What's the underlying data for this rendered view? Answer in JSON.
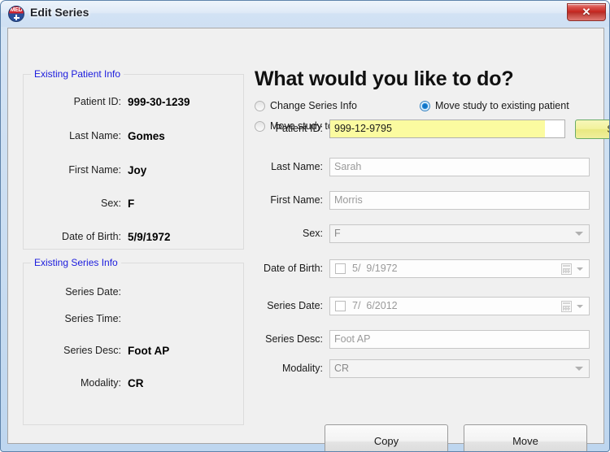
{
  "window": {
    "title": "Edit Series",
    "app_icon": "med-badge-icon",
    "close_label": "✕"
  },
  "existing_patient": {
    "legend": "Existing Patient Info",
    "rows": [
      {
        "label": "Patient ID:",
        "value": "999-30-1239"
      },
      {
        "label": "Last Name:",
        "value": "Gomes"
      },
      {
        "label": "First Name:",
        "value": "Joy"
      },
      {
        "label": "Sex:",
        "value": "F"
      },
      {
        "label": "Date of Birth:",
        "value": "5/9/1972"
      }
    ]
  },
  "existing_series": {
    "legend": "Existing Series Info",
    "rows": [
      {
        "label": "Series Date:",
        "value": ""
      },
      {
        "label": "Series Time:",
        "value": ""
      },
      {
        "label": "Series Desc:",
        "value": "Foot AP"
      },
      {
        "label": "Modality:",
        "value": "CR"
      }
    ]
  },
  "prompt": {
    "heading": "What would you like to do?",
    "options": [
      {
        "label": "Change Series Info",
        "selected": false
      },
      {
        "label": "Move study to new patient",
        "selected": false
      },
      {
        "label": "Move study to existing patient",
        "selected": true
      }
    ]
  },
  "form": {
    "patient_id_label": "Patient ID:",
    "patient_id_value": "999-12-9795",
    "search_label": "Search",
    "last_name_label": "Last Name:",
    "last_name_value": "Sarah",
    "first_name_label": "First Name:",
    "first_name_value": "Morris",
    "sex_label": "Sex:",
    "sex_value": "F",
    "dob_label": "Date of Birth:",
    "dob_value": "5/  9/1972",
    "series_date_label": "Series Date:",
    "series_date_value": "7/  6/2012",
    "series_desc_label": "Series Desc:",
    "series_desc_value": "Foot AP",
    "modality_label": "Modality:",
    "modality_value": "CR"
  },
  "actions": {
    "copy_label": "Copy",
    "move_label": "Move"
  },
  "colors": {
    "accent_blue": "#1b1bdd",
    "highlight_yellow": "#fbfba0",
    "search_border_green": "#6aab67",
    "close_red": "#c4241d"
  }
}
